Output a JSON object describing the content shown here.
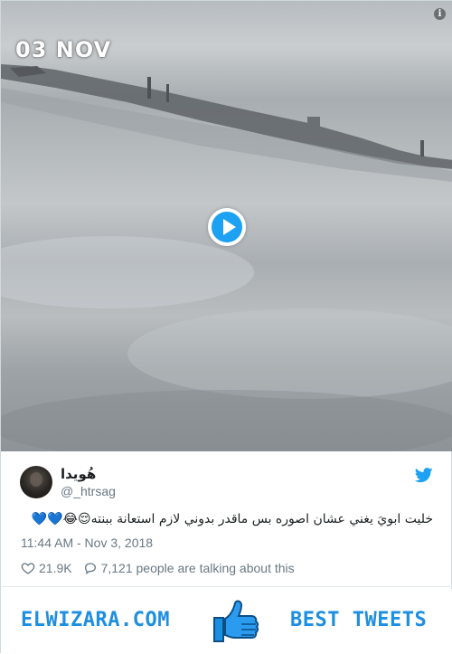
{
  "video": {
    "date_stamp": "03 NOV",
    "info_icon": "info-icon",
    "play_icon": "play-icon"
  },
  "tweet": {
    "display_name": "هُويدا",
    "handle": "@_htrsag",
    "text": "خليت ابويَ يغني عشان اصوره بس ماقدر بدوني لازم استعانة ببنته😌😂💙💙",
    "timestamp": "11:44 AM - Nov 3, 2018",
    "likes": "21.9K",
    "talking": "7,121 people are talking about this",
    "brand_icon": "twitter-bird-icon"
  },
  "banner": {
    "left_text": "ELWIZARA.COM",
    "right_text": "BEST TWEETS",
    "center_icon": "thumbs-up-icon"
  },
  "colors": {
    "accent": "#1da1f2",
    "banner_blue": "#1d8fe0",
    "text": "#1c2022",
    "muted": "#697882"
  }
}
